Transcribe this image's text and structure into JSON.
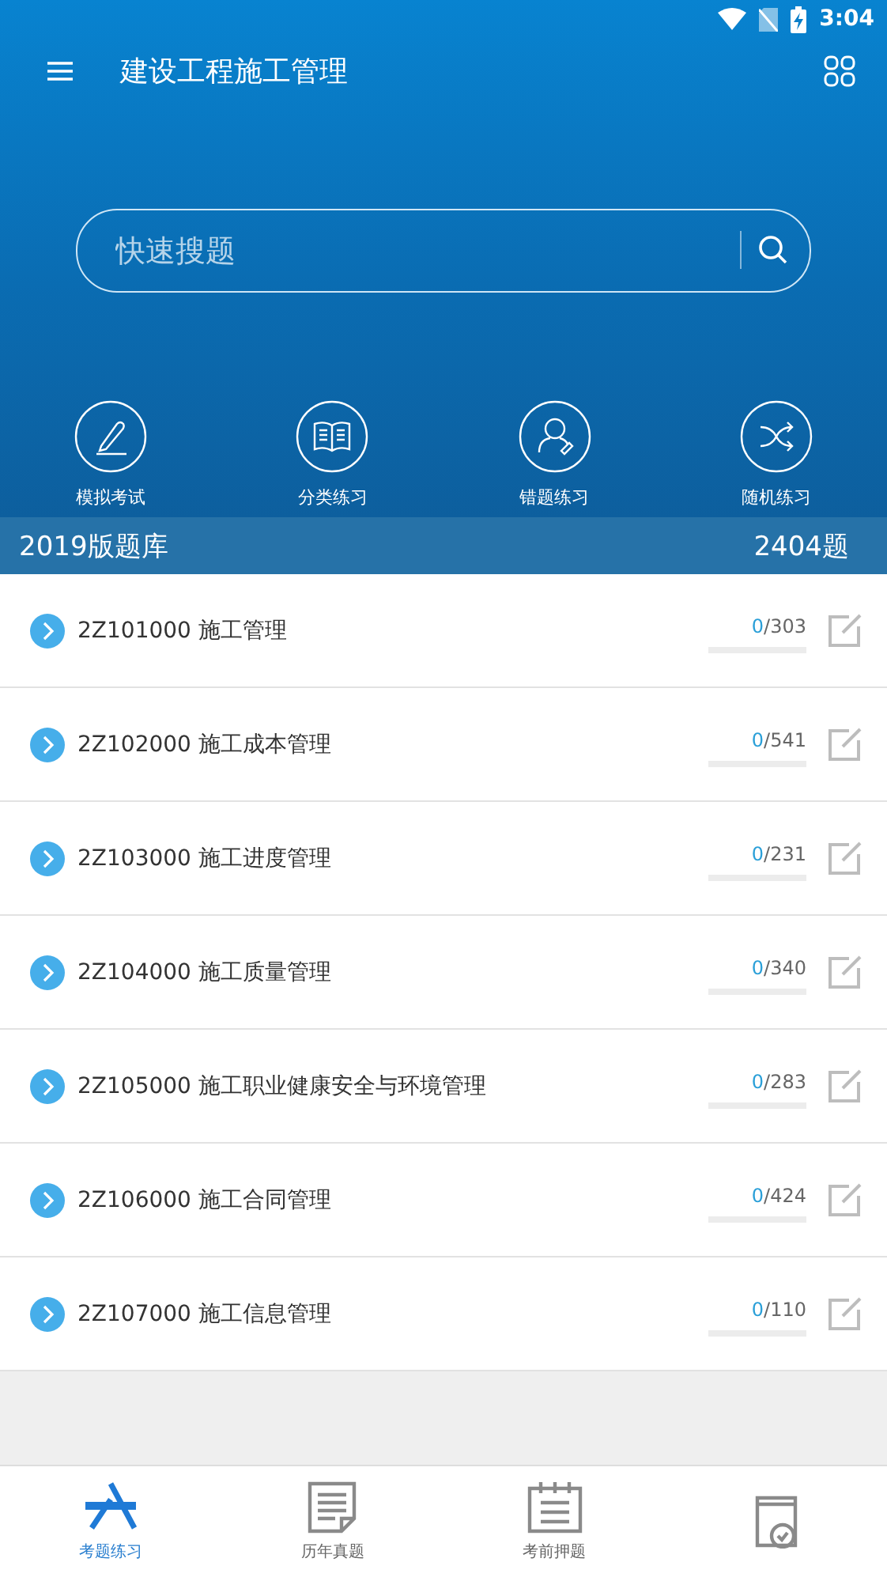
{
  "status_bar": {
    "time": "3:04"
  },
  "toolbar": {
    "title": "建设工程施工管理"
  },
  "search": {
    "placeholder": "快速搜题"
  },
  "shortcuts": [
    {
      "kind": "pen",
      "label": "模拟考试"
    },
    {
      "kind": "book",
      "label": "分类练习"
    },
    {
      "kind": "person",
      "label": "错题练习"
    },
    {
      "kind": "shuffle",
      "label": "随机练习"
    }
  ],
  "section": {
    "title": "2019版题库",
    "count": "2404题"
  },
  "chapters": [
    {
      "title": "2Z101000 施工管理",
      "done": "0",
      "total": "/303",
      "level": 0
    },
    {
      "title": "2Z102000 施工成本管理",
      "done": "0",
      "total": "/541",
      "level": 0
    },
    {
      "title": "2Z103000 施工进度管理",
      "done": "0",
      "total": "/231",
      "level": 0
    },
    {
      "title": "2Z104000 施工质量管理",
      "done": "0",
      "total": "/340",
      "level": 0
    },
    {
      "title": "2Z105000 施工职业健康安全与环境管理",
      "done": "0",
      "total": "/283",
      "level": 0
    },
    {
      "title": "2Z106000 施工合同管理",
      "done": "0",
      "total": "/424",
      "level": 0
    },
    {
      "title": "2Z107000 施工信息管理",
      "done": "0",
      "total": "/110",
      "level": 0
    }
  ],
  "bottom_nav": [
    {
      "kind": "store",
      "label": "考题练习",
      "selected": true
    },
    {
      "kind": "paper",
      "label": "历年真题",
      "selected": false
    },
    {
      "kind": "notepad",
      "label": "考前押题",
      "selected": false
    },
    {
      "kind": "bookcheck",
      "selected": false
    }
  ]
}
